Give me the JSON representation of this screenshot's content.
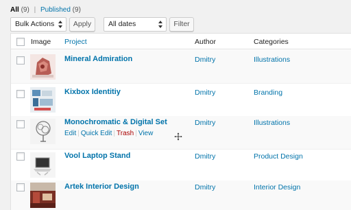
{
  "filters": {
    "all_label": "All",
    "all_count": "(9)",
    "published_label": "Published",
    "published_count": "(9)",
    "separator": "|"
  },
  "toolbar": {
    "bulk_actions": "Bulk Actions",
    "apply_label": "Apply",
    "dates": "All dates",
    "filter_label": "Filter"
  },
  "table": {
    "columns": {
      "image": "Image",
      "project": "Project",
      "author": "Author",
      "categories": "Categories"
    },
    "rows": [
      {
        "title": "Mineral Admiration",
        "author": "Dmitry",
        "category": "Illustrations"
      },
      {
        "title": "Kixbox Identitiy",
        "author": "Dmitry",
        "category": "Branding"
      },
      {
        "title": "Monochromatic & Digital Set",
        "author": "Dmitry",
        "category": "Illustrations",
        "actions": {
          "edit": "Edit",
          "quick_edit": "Quick Edit",
          "trash": "Trash",
          "view": "View",
          "sep": "|"
        }
      },
      {
        "title": "Vool Laptop Stand",
        "author": "Dmitry",
        "category": "Product Design"
      },
      {
        "title": "Artek Interior Design",
        "author": "Dmitry",
        "category": "Interior Design"
      }
    ]
  },
  "colors": {
    "link": "#0073aa",
    "trash": "#aa0000",
    "background": "#f1f1f1"
  },
  "icons": {
    "cursor": "move-cursor-icon",
    "select_arrows": "updown-arrows-icon"
  }
}
